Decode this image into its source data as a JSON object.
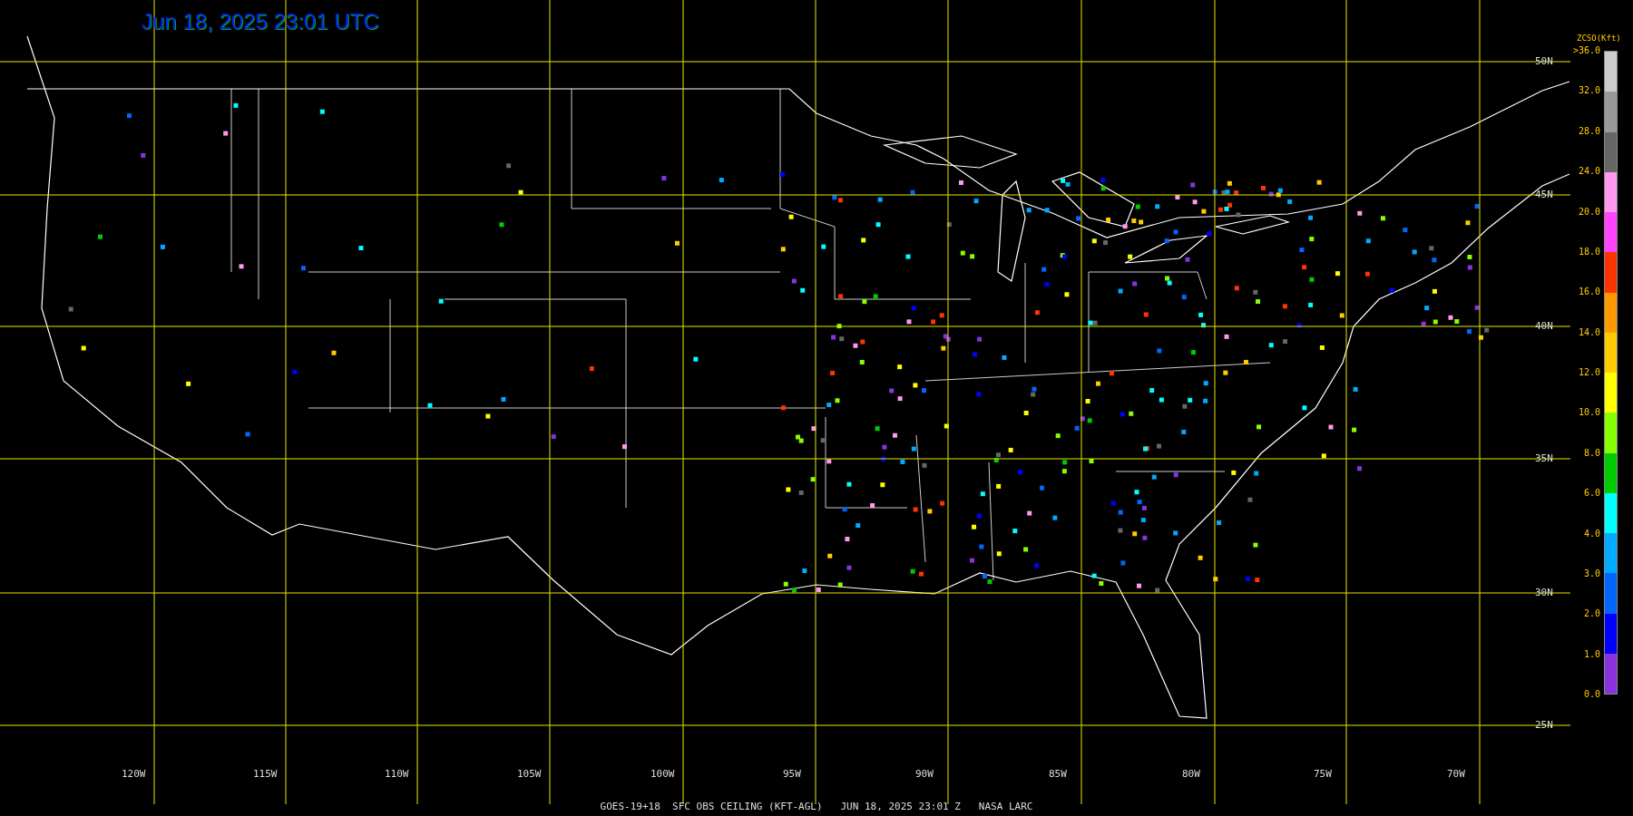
{
  "title": "Jun 18, 2025 23:01 UTC",
  "latitude_labels": [
    "50N",
    "45N",
    "40N",
    "35N",
    "30N",
    "25N"
  ],
  "longitude_labels": [
    "120W",
    "115W",
    "110W",
    "105W",
    "100W",
    "95W",
    "90W",
    "85W",
    "80W",
    "75W",
    "70W"
  ],
  "legend": {
    "title": "ZCSO(Kft)",
    "ticks": [
      ">36.0",
      "32.0",
      "28.0",
      "24.0",
      "20.0",
      "18.0",
      "16.0",
      "14.0",
      "12.0",
      "10.0",
      "8.0",
      "6.0",
      "4.0",
      "3.0",
      "2.0",
      "1.0",
      "0.0"
    ],
    "bands": [
      {
        "color": "#cccccc"
      },
      {
        "color": "#999999"
      },
      {
        "color": "#666666"
      },
      {
        "color": "#ff99ee"
      },
      {
        "color": "#ff44ff"
      },
      {
        "color": "#ff3300"
      },
      {
        "color": "#ff9900"
      },
      {
        "color": "#ffcc00"
      },
      {
        "color": "#ffff00"
      },
      {
        "color": "#88ff00"
      },
      {
        "color": "#00cc00"
      },
      {
        "color": "#00ffff"
      },
      {
        "color": "#00aaff"
      },
      {
        "color": "#0066ff"
      },
      {
        "color": "#0000ff"
      },
      {
        "color": "#8833dd"
      }
    ]
  },
  "caption": "GOES-19+18  SFC OBS CEILING (KFT-AGL)   JUN 18, 2025 23:01 Z   NASA LARC"
}
